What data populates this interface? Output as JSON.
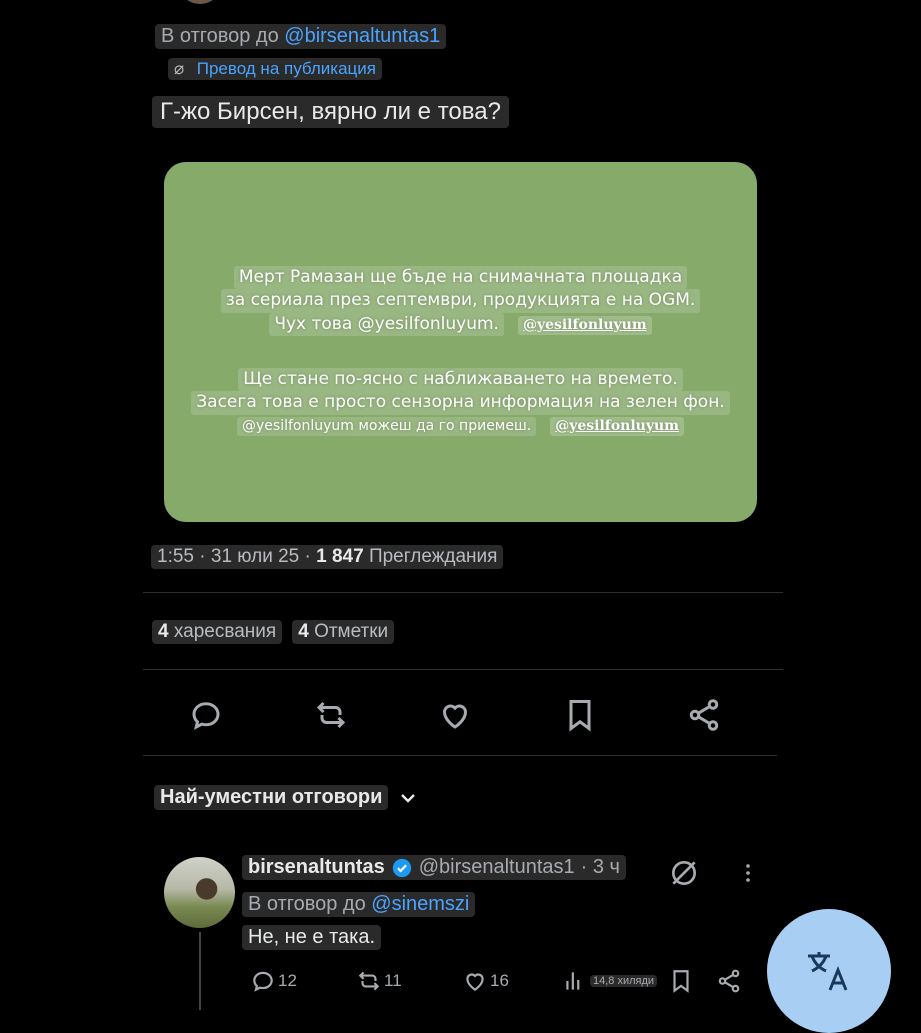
{
  "post": {
    "reply_prefix": "В отговор до",
    "reply_handle": "@birsenaltuntas1",
    "translate_label": "Превод на публикация",
    "text": "Г-жо Бирсен, вярно ли е това?",
    "media": {
      "lines": [
        "Мерт Рамазан ще бъде на снимачната площадка",
        "за сериала през септември, продукцията е на OGM.",
        "Чух това @yesilfonluyum.",
        "Ще стане по-ясно с наближаването на времето.",
        "Засега това е просто сензорна информация на зелен фон.",
        "@yesilfonluyum можеш да го приемеш."
      ],
      "tag": "@yesilfonluyum"
    },
    "meta": {
      "time": "1:55",
      "date": "31 юли 25",
      "views": "1 847",
      "views_label": "Преглеждания",
      "sep": "·"
    },
    "stats": {
      "likes": "4",
      "likes_label": "харесвания",
      "bookmarks": "4",
      "bookmarks_label": "Отметки"
    }
  },
  "sort": {
    "label": "Най-уместни отговори"
  },
  "reply": {
    "name": "birsenaltuntas",
    "handle": "@birsenaltuntas1",
    "time": "· 3 ч",
    "reply_prefix": "В отговор до",
    "reply_handle": "@sinemszi",
    "text": "Не, не е така.",
    "actions": {
      "replies": "12",
      "reposts": "11",
      "likes": "16",
      "views": "14,8 хиляди"
    }
  },
  "colors": {
    "accent": "#4aa3ff",
    "verified": "#1d9bf0",
    "media_bg": "#86aa6a",
    "fab": "#a8cff3"
  },
  "icons": [
    "reply-icon",
    "repost-icon",
    "like-icon",
    "bookmark-icon",
    "share-icon",
    "chevron-down-icon",
    "verified-icon",
    "grok-icon",
    "more-icon",
    "views-icon",
    "translate-icon"
  ]
}
